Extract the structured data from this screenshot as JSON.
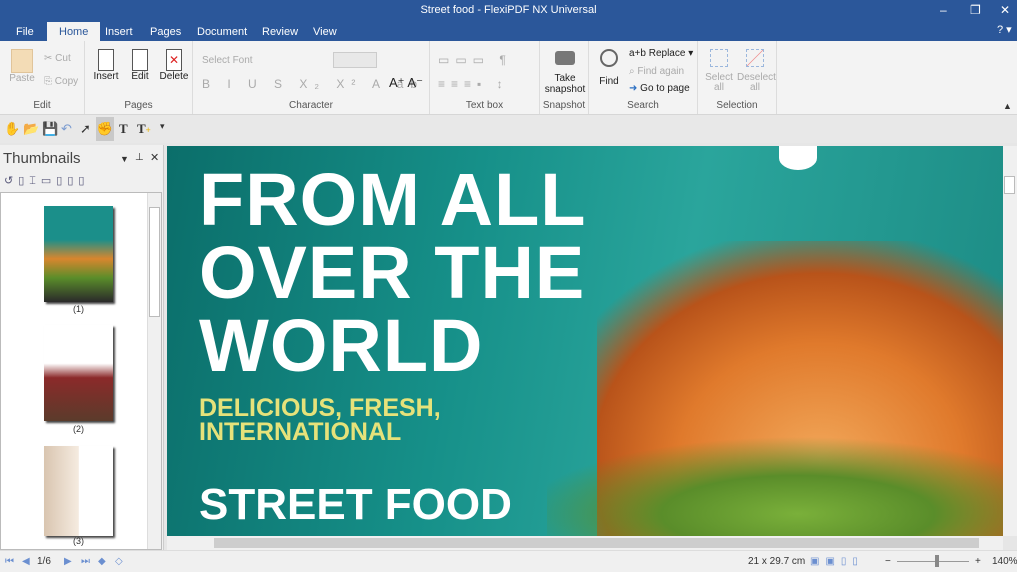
{
  "window": {
    "title": "Street food - FlexiPDF NX Universal",
    "help": "? ▾"
  },
  "tabs": [
    "File",
    "Home",
    "Insert",
    "Pages",
    "Document",
    "Review",
    "View"
  ],
  "ribbon": {
    "edit": {
      "label": "Edit",
      "paste": "Paste",
      "cut": "Cut",
      "copy": "Copy"
    },
    "pages": {
      "label": "Pages",
      "insert": "Insert",
      "edit": "Edit",
      "delete": "Delete"
    },
    "character": {
      "label": "Character",
      "font_placeholder": "Select Font"
    },
    "textbox": {
      "label": "Text box"
    },
    "snapshot": {
      "label": "Snapshot",
      "take": "Take snapshot"
    },
    "search": {
      "label": "Search",
      "find": "Find",
      "replace": "a+b Replace ▾",
      "find_again": "Find again",
      "goto": "Go to page"
    },
    "selection": {
      "label": "Selection",
      "select_all": "Select all",
      "deselect_all": "Deselect all"
    }
  },
  "panel": {
    "title": "Thumbnails",
    "thumbs": [
      "(1)",
      "(2)",
      "(3)"
    ]
  },
  "document": {
    "line1": "FROM ALL",
    "line2": "OVER THE",
    "line3": "WORLD",
    "sub1": "DELICIOUS, FRESH,",
    "sub2": "INTERNATIONAL",
    "bottom": "STREET FOOD"
  },
  "status": {
    "page": "1/6",
    "size": "21 x 29.7 cm",
    "zoom": "140%",
    "zoom_fraction": 0.55
  },
  "colors": {
    "titlebar": "#2b579a",
    "teal": "#169089",
    "yellow": "#e6e27a"
  }
}
